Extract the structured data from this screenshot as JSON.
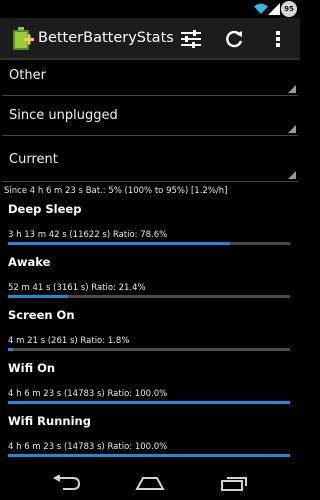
{
  "status_bar": {
    "battery_level": "95",
    "icons": [
      "wifi-icon",
      "signal-icon",
      "battery-icon"
    ]
  },
  "action_bar": {
    "title": "BetterBatteryStats",
    "icons": [
      "app-battery-icon",
      "tune-icon",
      "refresh-icon",
      "overflow-menu-icon"
    ]
  },
  "spinners": [
    {
      "value": "Other"
    },
    {
      "value": "Since unplugged"
    },
    {
      "value": "Current"
    }
  ],
  "summary": "Since 4 h 6 m 23 s  Bat.: 5% (100% to 95%) [1.2%/h]",
  "stats": [
    {
      "name": "Deep Sleep",
      "detail": "3 h 13 m 42 s  (11622 s) Ratio: 78.6%",
      "ratio": 78.6
    },
    {
      "name": "Awake",
      "detail": "52 m 41 s  (3161 s) Ratio: 21.4%",
      "ratio": 21.4
    },
    {
      "name": "Screen On",
      "detail": "4 m 21 s  (261 s) Ratio: 1.8%",
      "ratio": 1.8
    },
    {
      "name": "Wifi On",
      "detail": "4 h 6 m 23 s  (14783 s) Ratio: 100.0%",
      "ratio": 100.0
    },
    {
      "name": "Wifi Running",
      "detail": "4 h 6 m 23 s  (14783 s) Ratio: 100.0%",
      "ratio": 100.0
    }
  ],
  "colors": {
    "accent": "#1e88e5",
    "track": "#4a4a4a",
    "actionbar": "#1c1c1c",
    "background": "#000000"
  },
  "navigation": {
    "icons": [
      "back-icon",
      "home-icon",
      "recents-icon"
    ]
  }
}
